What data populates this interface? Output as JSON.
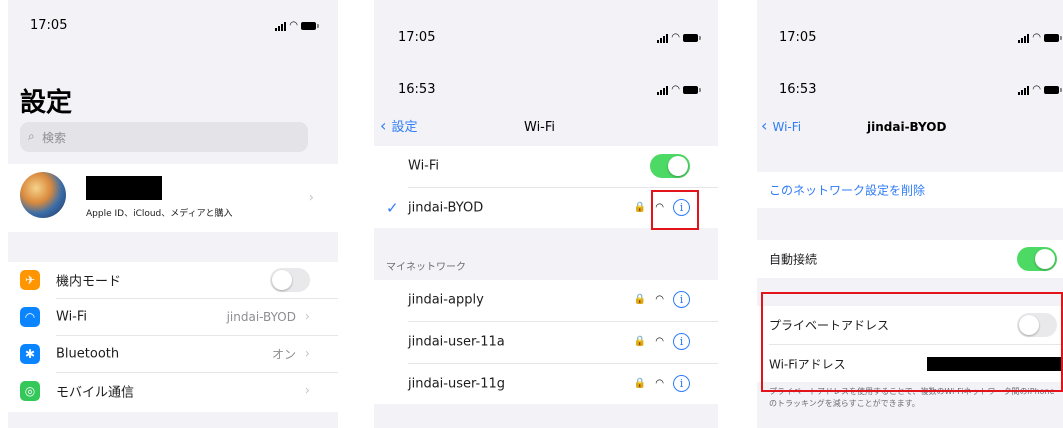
{
  "settings_screen": {
    "status_time": "17:05",
    "title": "設定",
    "search_placeholder": "検索",
    "profile_subtitle": "Apple ID、iCloud、メディアと購入",
    "rows": [
      {
        "label": "機内モード",
        "value": "",
        "icon": "airplane-icon",
        "color": "#ff9500"
      },
      {
        "label": "Wi-Fi",
        "value": "jindai-BYOD",
        "icon": "wifi-icon",
        "color": "#0a84ff"
      },
      {
        "label": "Bluetooth",
        "value": "オン",
        "icon": "bluetooth-icon",
        "color": "#0a84ff"
      },
      {
        "label": "モバイル通信",
        "value": "",
        "icon": "antenna-icon",
        "color": "#34c759"
      }
    ]
  },
  "wifi_screen": {
    "outer_time": "17:05",
    "status_time": "16:53",
    "back_label": "設定",
    "title": "Wi-Fi",
    "wifi_toggle_label": "Wi-Fi",
    "connected_network": "jindai-BYOD",
    "section_header": "マイネットワーク",
    "networks": [
      "jindai-apply",
      "jindai-user-11a",
      "jindai-user-11g"
    ]
  },
  "network_detail_screen": {
    "outer_time": "17:05",
    "status_time": "16:53",
    "back_label": "Wi-Fi",
    "title": "jindai-BYOD",
    "forget_label": "このネットワーク設定を削除",
    "auto_join_label": "自動接続",
    "private_address_label": "プライベートアドレス",
    "wifi_address_label": "Wi-Fiアドレス",
    "footer_text": "プライベートアドレスを使用することで、複数のWi-Fiネットワーク間のiPhoneのトラッキングを減らすことができます。"
  },
  "colors": {
    "accent": "#2f7cf6",
    "toggle_on": "#4cd964",
    "highlight_box": "#e3131b"
  }
}
